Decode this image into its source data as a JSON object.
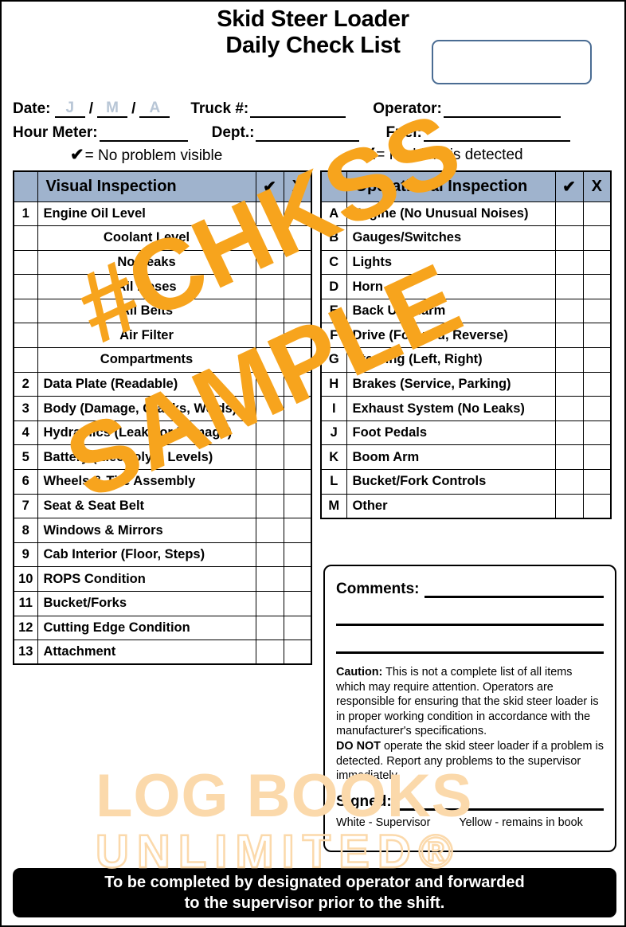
{
  "header": {
    "title_line1": "Skid Steer Loader",
    "title_line2": "Daily Check List",
    "unit_box_value": ""
  },
  "info": {
    "date_label": "Date:",
    "date_day": "J",
    "date_month": "M",
    "date_year": "A",
    "date_sep": "/",
    "truck_label": "Truck #:",
    "truck_value": "",
    "operator_label": "Operator:",
    "operator_value": "",
    "hour_meter_label": "Hour Meter:",
    "hour_meter_value": "",
    "dept_label": "Dept.:",
    "dept_value": "",
    "fuel_label": "Fuel:",
    "fuel_value": ""
  },
  "legend": {
    "check_symbol": "✔",
    "check_text": "= No problem visible",
    "x_symbol": "X",
    "x_text": "= Problem is detected"
  },
  "visual_table": {
    "title": "Visual Inspection",
    "col_check": "✔",
    "col_x": "X",
    "rows": [
      {
        "num": "1",
        "label": "Engine Oil Level",
        "sub": false
      },
      {
        "num": "",
        "label": "Coolant Level",
        "sub": true
      },
      {
        "num": "",
        "label": "No Leaks",
        "sub": true
      },
      {
        "num": "",
        "label": "All Hoses",
        "sub": true
      },
      {
        "num": "",
        "label": "All Belts",
        "sub": true
      },
      {
        "num": "",
        "label": "Air Filter",
        "sub": true
      },
      {
        "num": "",
        "label": "Compartments",
        "sub": true
      },
      {
        "num": "2",
        "label": "Data Plate (Readable)",
        "sub": false
      },
      {
        "num": "3",
        "label": "Body (Damage, Cracks, Welds)",
        "sub": false
      },
      {
        "num": "4",
        "label": "Hydraulics (Leaks or Damage)",
        "sub": false
      },
      {
        "num": "5",
        "label": "Battery (Electrolyte Levels)",
        "sub": false
      },
      {
        "num": "6",
        "label": "Wheels & Tire Assembly",
        "sub": false
      },
      {
        "num": "7",
        "label": "Seat & Seat Belt",
        "sub": false
      },
      {
        "num": "8",
        "label": "Windows & Mirrors",
        "sub": false
      },
      {
        "num": "9",
        "label": "Cab Interior (Floor, Steps)",
        "sub": false
      },
      {
        "num": "10",
        "label": "ROPS Condition",
        "sub": false
      },
      {
        "num": "11",
        "label": "Bucket/Forks",
        "sub": false
      },
      {
        "num": "12",
        "label": "Cutting Edge Condition",
        "sub": false
      },
      {
        "num": "13",
        "label": "Attachment",
        "sub": false
      }
    ]
  },
  "operational_table": {
    "title": "Operational Inspection",
    "col_check": "✔",
    "col_x": "X",
    "rows": [
      {
        "num": "A",
        "label": "Engine (No Unusual Noises)"
      },
      {
        "num": "B",
        "label": "Gauges/Switches"
      },
      {
        "num": "C",
        "label": "Lights"
      },
      {
        "num": "D",
        "label": "Horn"
      },
      {
        "num": "E",
        "label": "Back Up Alarm"
      },
      {
        "num": "F",
        "label": "Drive (Forward, Reverse)"
      },
      {
        "num": "G",
        "label": "Steering (Left, Right)"
      },
      {
        "num": "H",
        "label": "Brakes (Service, Parking)"
      },
      {
        "num": "I",
        "label": "Exhaust System (No Leaks)"
      },
      {
        "num": "J",
        "label": "Foot Pedals"
      },
      {
        "num": "K",
        "label": "Boom Arm"
      },
      {
        "num": "L",
        "label": "Bucket/Fork Controls"
      },
      {
        "num": "M",
        "label": "Other"
      }
    ]
  },
  "comments": {
    "label": "Comments:",
    "value": "",
    "caution_label": "Caution:",
    "caution_text": " This is not a complete list of all items which may require attention. Operators are responsible for ensuring that the skid steer loader is in proper working condition in accordance with the manufacturer's specifications.",
    "donot_label": "DO NOT",
    "donot_text": " operate the skid steer loader if a problem is detected. Report any problems to the supervisor immediately.",
    "signed_label": "Signed:",
    "signed_value": "",
    "copy_white": "White - Supervisor",
    "copy_yellow": "Yellow - remains in book"
  },
  "footer": {
    "line1": "To be completed by designated operator and forwarded",
    "line2": "to the supervisor prior to the shift."
  },
  "watermarks": {
    "sample_line1": "#CHKSS",
    "sample_line2": "SAMPLE",
    "brand_line1": "LOG BOOKS",
    "brand_line2": "UNLIMITED®"
  },
  "colors": {
    "table_header_fill": "#9fb3cd",
    "unit_box_border": "#4a6c93",
    "sample_watermark": "#f7a41d",
    "brand_watermark": "#fbd9ab",
    "footer_bg": "#000000",
    "date_placeholder": "#b8c6d6"
  }
}
